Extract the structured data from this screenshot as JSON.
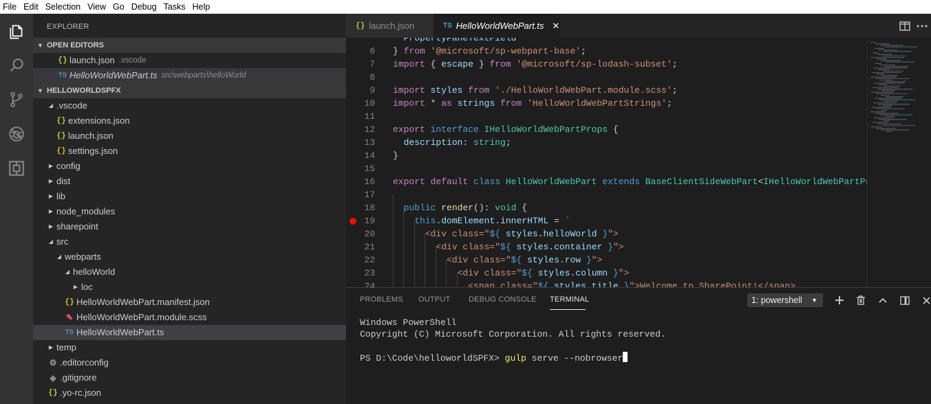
{
  "menu": [
    "File",
    "Edit",
    "Selection",
    "View",
    "Go",
    "Debug",
    "Tasks",
    "Help"
  ],
  "activity_bar": [
    {
      "icon": "explorer-icon"
    },
    {
      "icon": "search-icon"
    },
    {
      "icon": "source-control-icon"
    },
    {
      "icon": "debug-icon"
    },
    {
      "icon": "extensions-icon"
    }
  ],
  "sidebar": {
    "title": "EXPLORER",
    "open_editors": {
      "header": "OPEN EDITORS",
      "items": [
        {
          "icon": "{}",
          "name": "launch.json",
          "desc": ".vscode"
        },
        {
          "icon": "TS",
          "name": "HelloWorldWebPart.ts",
          "desc": "src\\webparts\\helloWorld"
        }
      ]
    },
    "project": {
      "header": "HELLOWORLDSPFX",
      "tree": [
        {
          "icon": "",
          "twist": "▲",
          "name": ".vscode"
        },
        {
          "icon": "{}",
          "twist": "",
          "name": "extensions.json"
        },
        {
          "icon": "{}",
          "twist": "",
          "name": "launch.json"
        },
        {
          "icon": "{}",
          "twist": "",
          "name": "settings.json"
        },
        {
          "icon": "",
          "twist": "▶",
          "name": "config"
        },
        {
          "icon": "",
          "twist": "▶",
          "name": "dist"
        },
        {
          "icon": "",
          "twist": "▶",
          "name": "lib"
        },
        {
          "icon": "",
          "twist": "▶",
          "name": "node_modules"
        },
        {
          "icon": "",
          "twist": "▶",
          "name": "sharepoint"
        },
        {
          "icon": "",
          "twist": "▲",
          "name": "src"
        },
        {
          "icon": "",
          "twist": "▲",
          "name": "webparts"
        },
        {
          "icon": "",
          "twist": "▲",
          "name": "helloWorld"
        },
        {
          "icon": "",
          "twist": "▶",
          "name": "loc"
        },
        {
          "icon": "{}",
          "twist": "",
          "name": "HelloWorldWebPart.manifest.json"
        },
        {
          "icon": "scss",
          "twist": "",
          "name": "HelloWorldWebPart.module.scss"
        },
        {
          "icon": "TS",
          "twist": "",
          "name": "HelloWorldWebPart.ts"
        },
        {
          "icon": "",
          "twist": "▶",
          "name": "temp"
        },
        {
          "icon": "gear",
          "twist": "",
          "name": ".editorconfig"
        },
        {
          "icon": "git",
          "twist": "",
          "name": ".gitignore"
        },
        {
          "icon": "{}",
          "twist": "",
          "name": ".yo-rc.json"
        }
      ]
    }
  },
  "editor": {
    "tabs": [
      {
        "icon": "{}",
        "label": "launch.json"
      },
      {
        "icon": "TS",
        "label": "HelloWorldWebPart.ts",
        "close": "✕"
      }
    ],
    "lines": [
      {
        "n": "",
        "tokens": [
          [
            "pl",
            "  "
          ],
          [
            "vr",
            "PropertyPaneTextField"
          ]
        ]
      },
      {
        "n": "6",
        "tokens": [
          [
            "pl",
            "} "
          ],
          [
            "kw2",
            "from"
          ],
          [
            "pl",
            " "
          ],
          [
            "str",
            "'@microsoft/sp-webpart-base'"
          ],
          [
            "pl",
            ";"
          ]
        ]
      },
      {
        "n": "7",
        "tokens": [
          [
            "kw2",
            "import"
          ],
          [
            "pl",
            " { "
          ],
          [
            "vr",
            "escape"
          ],
          [
            "pl",
            " } "
          ],
          [
            "kw2",
            "from"
          ],
          [
            "pl",
            " "
          ],
          [
            "str",
            "'@microsoft/sp-lodash-subset'"
          ],
          [
            "pl",
            ";"
          ]
        ]
      },
      {
        "n": "8",
        "tokens": []
      },
      {
        "n": "9",
        "tokens": [
          [
            "kw2",
            "import"
          ],
          [
            "pl",
            " "
          ],
          [
            "vr",
            "styles"
          ],
          [
            "pl",
            " "
          ],
          [
            "kw2",
            "from"
          ],
          [
            "pl",
            " "
          ],
          [
            "str",
            "'./HelloWorldWebPart.module.scss'"
          ],
          [
            "pl",
            ";"
          ]
        ]
      },
      {
        "n": "10",
        "tokens": [
          [
            "kw2",
            "import"
          ],
          [
            "pl",
            " * "
          ],
          [
            "kw2",
            "as"
          ],
          [
            "pl",
            " "
          ],
          [
            "vr",
            "strings"
          ],
          [
            "pl",
            " "
          ],
          [
            "kw2",
            "from"
          ],
          [
            "pl",
            " "
          ],
          [
            "str",
            "'HelloWorldWebPartStrings'"
          ],
          [
            "pl",
            ";"
          ]
        ]
      },
      {
        "n": "11",
        "tokens": []
      },
      {
        "n": "12",
        "tokens": [
          [
            "kw2",
            "export"
          ],
          [
            "pl",
            " "
          ],
          [
            "kw",
            "interface"
          ],
          [
            "pl",
            " "
          ],
          [
            "ty",
            "IHelloWorldWebPartProps"
          ],
          [
            "pl",
            " {"
          ]
        ]
      },
      {
        "n": "13",
        "tokens": [
          [
            "pl",
            "  "
          ],
          [
            "vr",
            "description"
          ],
          [
            "pl",
            ": "
          ],
          [
            "ty",
            "string"
          ],
          [
            "pl",
            ";"
          ]
        ]
      },
      {
        "n": "14",
        "tokens": [
          [
            "pl",
            "}"
          ]
        ]
      },
      {
        "n": "15",
        "tokens": []
      },
      {
        "n": "16",
        "tokens": [
          [
            "kw2",
            "export"
          ],
          [
            "pl",
            " "
          ],
          [
            "kw2",
            "default"
          ],
          [
            "pl",
            " "
          ],
          [
            "kw",
            "class"
          ],
          [
            "pl",
            " "
          ],
          [
            "ty",
            "HelloWorldWebPart"
          ],
          [
            "pl",
            " "
          ],
          [
            "kw",
            "extends"
          ],
          [
            "pl",
            " "
          ],
          [
            "ty",
            "BaseClientSideWebPart"
          ],
          [
            "pl",
            "<"
          ],
          [
            "ty",
            "IHelloWorldWebPartPro"
          ]
        ]
      },
      {
        "n": "17",
        "tokens": []
      },
      {
        "n": "18",
        "tokens": [
          [
            "pl",
            "  "
          ],
          [
            "kw",
            "public"
          ],
          [
            "pl",
            " "
          ],
          [
            "fn",
            "render"
          ],
          [
            "pl",
            "(): "
          ],
          [
            "ty",
            "void"
          ],
          [
            "pl",
            " {"
          ]
        ]
      },
      {
        "n": "19",
        "tokens": [
          [
            "pl",
            "    "
          ],
          [
            "kw",
            "this"
          ],
          [
            "pl",
            "."
          ],
          [
            "vr",
            "domElement"
          ],
          [
            "pl",
            "."
          ],
          [
            "vr",
            "innerHTML"
          ],
          [
            "pl",
            " = "
          ],
          [
            "str",
            "`"
          ]
        ],
        "breakpoint": true
      },
      {
        "n": "20",
        "tokens": [
          [
            "pl",
            "      "
          ],
          [
            "str",
            "<div class=\""
          ],
          [
            "kw",
            "${"
          ],
          [
            "pl",
            " "
          ],
          [
            "vr",
            "styles"
          ],
          [
            "pl",
            "."
          ],
          [
            "vr",
            "helloWorld"
          ],
          [
            "pl",
            " "
          ],
          [
            "kw",
            "}"
          ],
          [
            "str",
            "\">"
          ]
        ]
      },
      {
        "n": "21",
        "tokens": [
          [
            "pl",
            "        "
          ],
          [
            "str",
            "<div class=\""
          ],
          [
            "kw",
            "${"
          ],
          [
            "pl",
            " "
          ],
          [
            "vr",
            "styles"
          ],
          [
            "pl",
            "."
          ],
          [
            "vr",
            "container"
          ],
          [
            "pl",
            " "
          ],
          [
            "kw",
            "}"
          ],
          [
            "str",
            "\">"
          ]
        ]
      },
      {
        "n": "22",
        "tokens": [
          [
            "pl",
            "          "
          ],
          [
            "str",
            "<div class=\""
          ],
          [
            "kw",
            "${"
          ],
          [
            "pl",
            " "
          ],
          [
            "vr",
            "styles"
          ],
          [
            "pl",
            "."
          ],
          [
            "vr",
            "row"
          ],
          [
            "pl",
            " "
          ],
          [
            "kw",
            "}"
          ],
          [
            "str",
            "\">"
          ]
        ]
      },
      {
        "n": "23",
        "tokens": [
          [
            "pl",
            "            "
          ],
          [
            "str",
            "<div class=\""
          ],
          [
            "kw",
            "${"
          ],
          [
            "pl",
            " "
          ],
          [
            "vr",
            "styles"
          ],
          [
            "pl",
            "."
          ],
          [
            "vr",
            "column"
          ],
          [
            "pl",
            " "
          ],
          [
            "kw",
            "}"
          ],
          [
            "str",
            "\">"
          ]
        ]
      },
      {
        "n": "24",
        "tokens": [
          [
            "pl",
            "              "
          ],
          [
            "str",
            "<span class=\""
          ],
          [
            "kw",
            "${"
          ],
          [
            "pl",
            " "
          ],
          [
            "vr",
            "styles"
          ],
          [
            "pl",
            "."
          ],
          [
            "vr",
            "title"
          ],
          [
            "pl",
            " "
          ],
          [
            "kw",
            "}"
          ],
          [
            "str",
            "\">Welcome to SharePoint!</span>"
          ]
        ]
      }
    ]
  },
  "panel": {
    "tabs": [
      "PROBLEMS",
      "OUTPUT",
      "DEBUG CONSOLE",
      "TERMINAL"
    ],
    "active_tab": "TERMINAL",
    "terminal_select": "1: powershell",
    "terminal_lines": [
      "Windows PowerShell",
      "Copyright (C) Microsoft Corporation. All rights reserved."
    ],
    "prompt": "PS D:\\Code\\helloworldSPFX> ",
    "command_name": "gulp",
    "command_args": " serve --nobrowser"
  },
  "colors": {
    "accent_blue": "#519aba",
    "json_yellow": "#cbcb41",
    "breakpoint_red": "#e51400",
    "command_yellow": "#f0e67a"
  }
}
